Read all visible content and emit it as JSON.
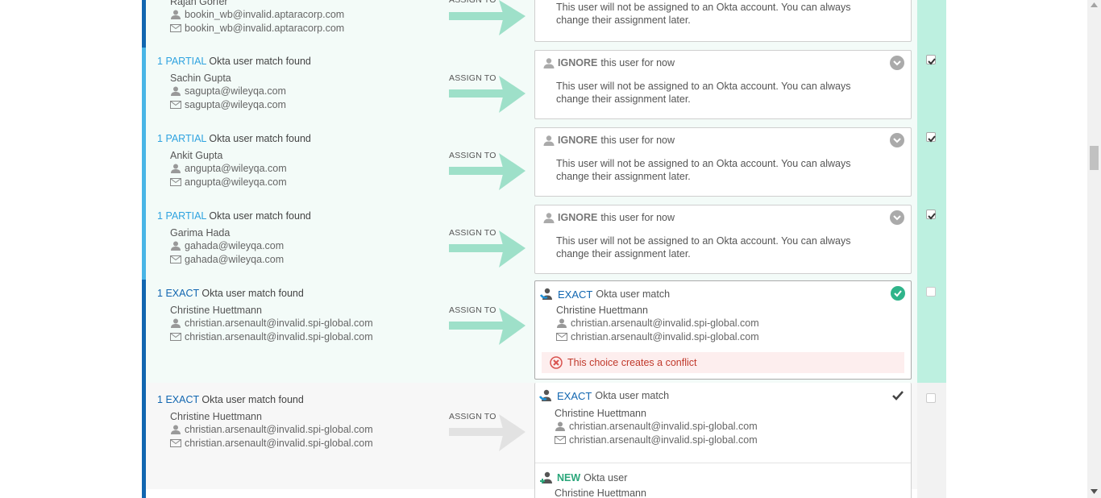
{
  "colors": {
    "partial": "#2fa3e0",
    "exact": "#1166b0",
    "check_column_active": "#bdf0e0",
    "row_active_bg": "#f3fbf8",
    "row_inactive_bg": "#f7f7f7",
    "arrow_active": "#9ee0c9",
    "arrow_inactive": "#e2e2e2"
  },
  "assign_label": "ASSIGN TO",
  "ignore_text": "This user will not be assigned to an Okta account. You can always change their assignment later.",
  "rows": [
    {
      "name": "Rajan Gorfer",
      "login": "bookin_wb@invalid.aptaracorp.com",
      "email": "bookin_wb@invalid.aptaracorp.com",
      "checked": true
    },
    {
      "match_count": "1",
      "match_level": "PARTIAL",
      "match_suffix": "Okta user match found",
      "name": "Sachin Gupta",
      "login": "sagupta@wileyqa.com",
      "email": "sagupta@wileyqa.com",
      "card_keyword": "IGNORE",
      "card_suffix": "this user for now",
      "checked": true
    },
    {
      "match_count": "1",
      "match_level": "PARTIAL",
      "match_suffix": "Okta user match found",
      "name": "Ankit Gupta",
      "login": "angupta@wileyqa.com",
      "email": "angupta@wileyqa.com",
      "card_keyword": "IGNORE",
      "card_suffix": "this user for now",
      "checked": true
    },
    {
      "match_count": "1",
      "match_level": "PARTIAL",
      "match_suffix": "Okta user match found",
      "name": "Garima Hada",
      "login": "gahada@wileyqa.com",
      "email": "gahada@wileyqa.com",
      "card_keyword": "IGNORE",
      "card_suffix": "this user for now",
      "checked": true
    },
    {
      "match_count": "1",
      "match_level": "EXACT",
      "match_suffix": "Okta user match found",
      "name": "Christine Huettmann",
      "login": "christian.arsenault@invalid.spi-global.com",
      "email": "christian.arsenault@invalid.spi-global.com",
      "card_keyword": "EXACT",
      "card_suffix": "Okta user match",
      "card_name": "Christine Huettmann",
      "card_login": "christian.arsenault@invalid.spi-global.com",
      "card_email": "christian.arsenault@invalid.spi-global.com",
      "conflict_text": "This choice creates a conflict",
      "checked": false
    },
    {
      "match_count": "1",
      "match_level": "EXACT",
      "match_suffix": "Okta user match found",
      "name": "Christine Huettmann",
      "login": "christian.arsenault@invalid.spi-global.com",
      "email": "christian.arsenault@invalid.spi-global.com",
      "card_keyword": "EXACT",
      "card_suffix": "Okta user match",
      "card_name": "Christine Huettmann",
      "card_login": "christian.arsenault@invalid.spi-global.com",
      "card_email": "christian.arsenault@invalid.spi-global.com",
      "new_keyword": "NEW",
      "new_suffix": "Okta user",
      "new_name": "Christine Huettmann",
      "checked": false
    }
  ]
}
